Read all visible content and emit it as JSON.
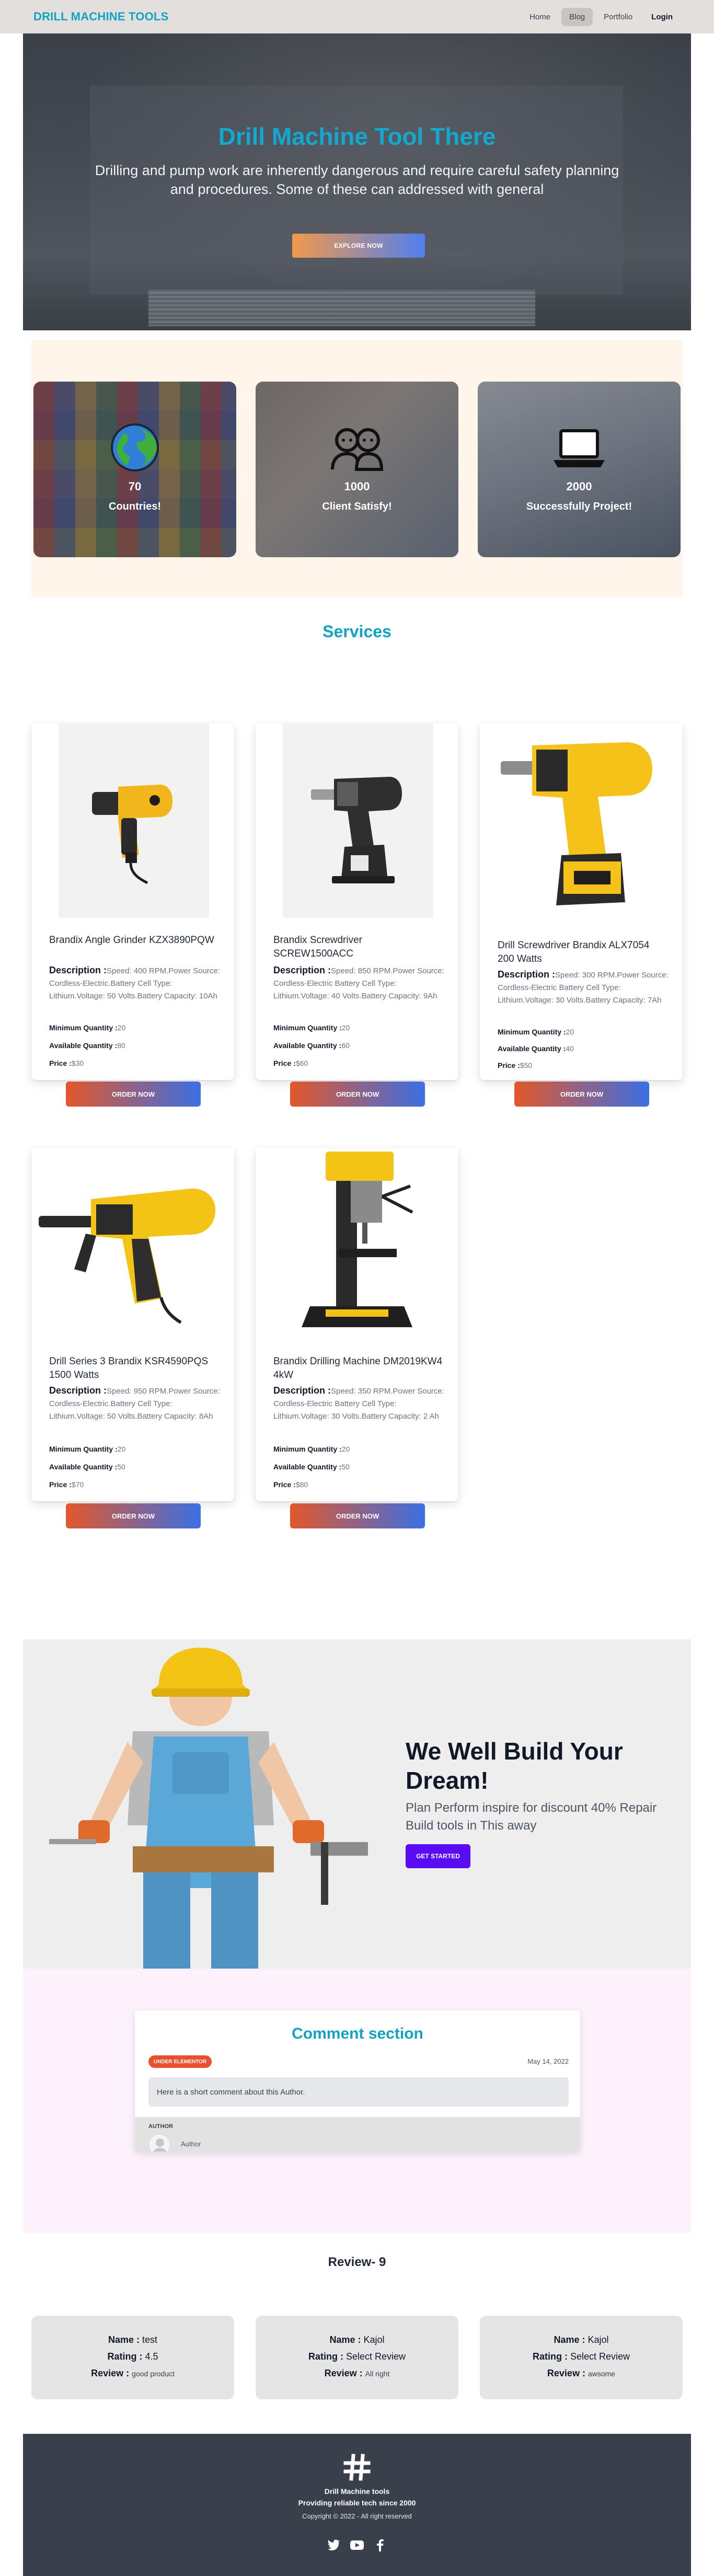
{
  "nav": {
    "brand": "DRILL MACHINE TOOLS",
    "items": [
      {
        "label": "Home"
      },
      {
        "label": "Blog"
      },
      {
        "label": "Portfolio"
      },
      {
        "label": "Login"
      }
    ],
    "active": "Blog"
  },
  "hero": {
    "title": "Drill Machine Tool There",
    "text": "Drilling and pump work are inherently dangerous and require careful safety planning and procedures. Some of these can addressed with general",
    "button": "EXPLORE NOW"
  },
  "stats": [
    {
      "icon": "globe-icon",
      "value": "70",
      "label": "Countries!"
    },
    {
      "icon": "users-icon",
      "value": "1000",
      "label": "Client Satisfy!"
    },
    {
      "icon": "laptop-icon",
      "value": "2000",
      "label": "Successfully Project!"
    }
  ],
  "services": {
    "title": "Services",
    "products": [
      {
        "name": "Brandix Angle Grinder KZX3890PQW",
        "desc_label": "Description :",
        "desc": "Speed: 400 RPM.Power Source: Cordless-Electric.Battery Cell Type: Lithium.Voltage: 50 Volts.Battery Capacity: 10Ah",
        "min_label": "Minimum Quantity :",
        "min": "20",
        "avail_label": "Available Quantity :",
        "avail": "80",
        "price_label": "Price :",
        "price": "$30",
        "button": "ORDER NOW",
        "image": "heat-gun-icon"
      },
      {
        "name": "Brandix Screwdriver SCREW1500ACC",
        "desc_label": "Description :",
        "desc": "Speed: 850 RPM.Power Source: Cordless-Electric Battery Cell Type: Lithium.Voltage: 40 Volts.Battery Capacity: 9Ah",
        "min_label": "Minimum Quantity :",
        "min": "20",
        "avail_label": "Available Quantity :",
        "avail": "60",
        "price_label": "Price :",
        "price": "$60",
        "button": "ORDER NOW",
        "image": "cordless-drill-icon"
      },
      {
        "name": "Drill Screwdriver Brandix ALX7054 200 Watts",
        "desc_label": "Description :",
        "desc": "Speed: 300 RPM.Power Source: Cordless-Electric Battery Cell Type: Lithium.Voltage: 30 Volts.Battery Capacity: 7Ah",
        "min_label": "Minimum Quantity :",
        "min": "20",
        "avail_label": "Available Quantity :",
        "avail": "40",
        "price_label": "Price :",
        "price": "$50",
        "button": "ORDER NOW",
        "image": "yellow-drill-icon"
      },
      {
        "name": "Drill Series 3 Brandix KSR4590PQS 1500 Watts",
        "desc_label": "Description :",
        "desc": "Speed: 950 RPM.Power Source: Cordless-Electric.Battery Cell Type: Lithium.Voltage: 50 Volts.Battery Capacity: 8Ah",
        "min_label": "Minimum Quantity :",
        "min": "20",
        "avail_label": "Available Quantity :",
        "avail": "50",
        "price_label": "Price :",
        "price": "$70",
        "button": "ORDER NOW",
        "image": "hammer-drill-icon"
      },
      {
        "name": "Brandix Drilling Machine DM2019KW4 4kW",
        "desc_label": "Description :",
        "desc": "Speed: 350 RPM.Power Source: Cordless-Electric Battery Cell Type: Lithium.Voltage: 30 Volts.Battery Capacity: 2 Ah",
        "min_label": "Minimum Quantity :",
        "min": "20",
        "avail_label": "Available Quantity :",
        "avail": "50",
        "price_label": "Price :",
        "price": "$80",
        "button": "ORDER NOW",
        "image": "drill-press-icon"
      }
    ]
  },
  "banner": {
    "title": "We Well Build Your Dream!",
    "text": "Plan Perform inspire for discount 40% Repair Build tools in This away",
    "button": "GET STARTED"
  },
  "comment": {
    "title": "Comment section",
    "badge": "UNDER ELEMENTOR",
    "date": "May 14, 2022",
    "body": "Here is a short comment about this Author.",
    "author_label": "AUTHOR",
    "author_name": "Author"
  },
  "reviews": {
    "heading": "Review- 9",
    "items": [
      {
        "name_label": "Name :",
        "name": "test",
        "rating_label": "Rating :",
        "rating": "4.5",
        "review_label": "Review :",
        "review": "good product"
      },
      {
        "name_label": "Name :",
        "name": "Kajol",
        "rating_label": "Rating :",
        "rating": "Select Review",
        "review_label": "Review :",
        "review": "All right"
      },
      {
        "name_label": "Name :",
        "name": "Kajol",
        "rating_label": "Rating :",
        "rating": "Select Review",
        "review_label": "Review :",
        "review": "awsome"
      }
    ]
  },
  "footer": {
    "logo": "hashtag-logo-icon",
    "title": "Drill Machine tools",
    "tagline": "Providing reliable tech since 2000",
    "copyright": "Copyright © 2022 - All right reserved",
    "socials": [
      "twitter-icon",
      "youtube-icon",
      "facebook-icon"
    ]
  }
}
